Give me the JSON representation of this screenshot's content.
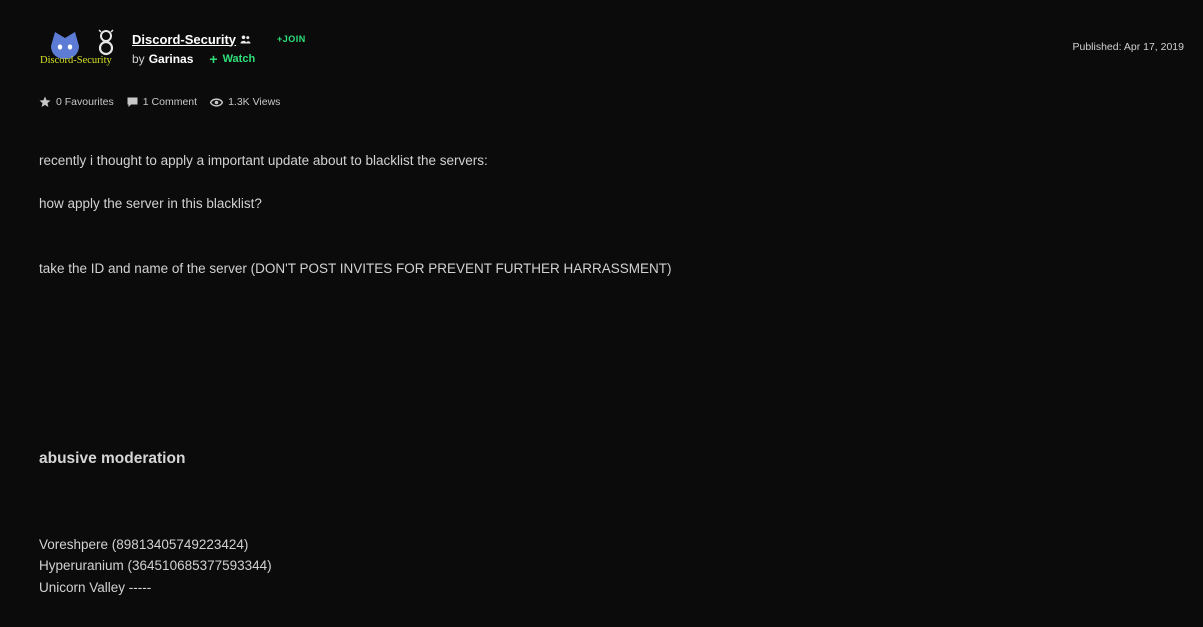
{
  "deviation": {
    "group_name": "Discord-Security",
    "avatar_caption": "Discord-Security",
    "join_label": "+JOIN",
    "by_label": "by",
    "author": "Garinas",
    "watch_label": "Watch",
    "published": "Published: Apr 17, 2019"
  },
  "stats": {
    "favourites": "0 Favourites",
    "comments": "1 Comment",
    "views": "1.3K Views"
  },
  "content": {
    "line1": "recently i thought to apply a important update about to blacklist the servers:",
    "line2": "how apply the server in this blacklist?",
    "line3": "take the ID and name of the server (DON'T POST INVITES FOR PREVENT FURTHER HARRASSMENT)",
    "heading": "abusive moderation",
    "servers": [
      "Voreshpere (89813405749223424)",
      "Hyperuranium (364510685377593344)",
      "Unicorn Valley -----"
    ]
  },
  "colors": {
    "background": "#0b0b0c",
    "accent_green": "#2fe07a",
    "avatar_blue": "#5b7bd5",
    "avatar_text": "#d4e021"
  },
  "icons": {
    "group": "group-members-icon",
    "favourite": "star-icon",
    "comment": "comment-bubble-icon",
    "views": "eye-icon"
  }
}
